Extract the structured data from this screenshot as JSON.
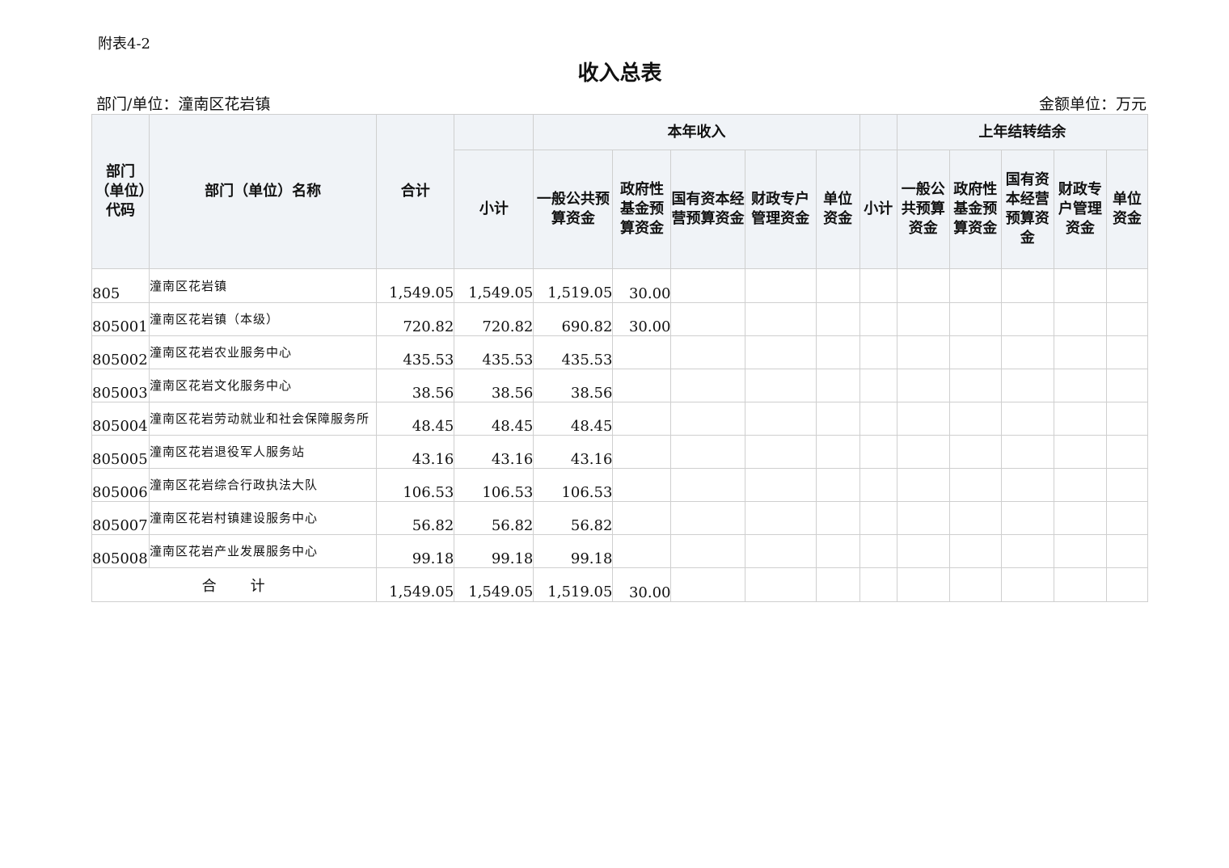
{
  "annex_label": "附表4-2",
  "title": "收入总表",
  "dept_label": "部门/单位：潼南区花岩镇",
  "unit_label": "金额单位：万元",
  "header": {
    "code": "部门（单位）代码",
    "name": "部门（单位）名称",
    "total": "合计",
    "this_year": "本年收入",
    "last_year": "上年结转结余",
    "sub_cols": [
      "小计",
      "一般公共预算资金",
      "政府性基金预算资金",
      "国有资本经营预算资金",
      "财政专户管理资金",
      "单位资金"
    ],
    "ly_cols": [
      "小计",
      "一般公共预算资金",
      "政府性基金预算资金",
      "国有资本经营预算资金",
      "财政专户管理资金",
      "单位资金"
    ]
  },
  "rows": [
    {
      "code": "805",
      "name": "潼南区花岩镇",
      "total": "1,549.05",
      "subtotal": "1,549.05",
      "general": "1,519.05",
      "fund": "30.00"
    },
    {
      "code": "805001",
      "name": "潼南区花岩镇（本级）",
      "total": "720.82",
      "subtotal": "720.82",
      "general": "690.82",
      "fund": "30.00"
    },
    {
      "code": "805002",
      "name": "潼南区花岩农业服务中心",
      "total": "435.53",
      "subtotal": "435.53",
      "general": "435.53",
      "fund": ""
    },
    {
      "code": "805003",
      "name": "潼南区花岩文化服务中心",
      "total": "38.56",
      "subtotal": "38.56",
      "general": "38.56",
      "fund": ""
    },
    {
      "code": "805004",
      "name": "潼南区花岩劳动就业和社会保障服务所",
      "total": "48.45",
      "subtotal": "48.45",
      "general": "48.45",
      "fund": ""
    },
    {
      "code": "805005",
      "name": "潼南区花岩退役军人服务站",
      "total": "43.16",
      "subtotal": "43.16",
      "general": "43.16",
      "fund": ""
    },
    {
      "code": "805006",
      "name": "潼南区花岩综合行政执法大队",
      "total": "106.53",
      "subtotal": "106.53",
      "general": "106.53",
      "fund": ""
    },
    {
      "code": "805007",
      "name": "潼南区花岩村镇建设服务中心",
      "total": "56.82",
      "subtotal": "56.82",
      "general": "56.82",
      "fund": ""
    },
    {
      "code": "805008",
      "name": "潼南区花岩产业发展服务中心",
      "total": "99.18",
      "subtotal": "99.18",
      "general": "99.18",
      "fund": ""
    }
  ],
  "totals": {
    "label_a": "合",
    "label_b": "计",
    "total": "1,549.05",
    "subtotal": "1,549.05",
    "general": "1,519.05",
    "fund": "30.00"
  }
}
